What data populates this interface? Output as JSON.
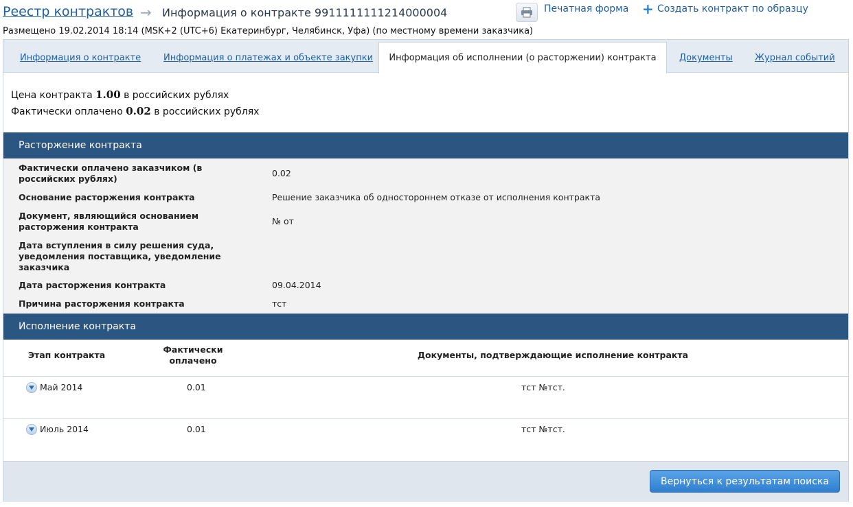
{
  "header": {
    "breadcrumb_root": "Реестр контрактов",
    "arrow_icon": "arrow-right-icon",
    "title": "Информация о контракте 9911111111214000004",
    "print_label": "Печатная форма",
    "print_icon": "printer-icon",
    "create_label": "Создать контракт по образцу",
    "create_icon": "plus-icon"
  },
  "posted": "Размещено 19.02.2014 18:14 (MSK+2 (UTC+6) Екатеринбург, Челябинск, Уфа) (по местному времени заказчика)",
  "tabs": [
    {
      "label": "Информация о контракте"
    },
    {
      "label": "Информация о платежах и объекте закупки"
    },
    {
      "label": "Информация об исполнении (о расторжении) контракта",
      "active": true
    },
    {
      "label": "Документы"
    },
    {
      "label": "Журнал событий"
    }
  ],
  "price": {
    "price_prefix": "Цена контракта",
    "price_value": "1.00",
    "price_suffix": "в российских рублях",
    "paid_prefix": "Фактически оплачено",
    "paid_value": "0.02",
    "paid_suffix": "в российских рублях"
  },
  "termination": {
    "title": "Расторжение контракта",
    "rows": [
      {
        "label": "Фактически оплачено заказчиком (в российских рублях)",
        "value": "0.02"
      },
      {
        "label": "Основание расторжения контракта",
        "value": "Решение заказчика об одностороннем отказе от исполнения контракта"
      },
      {
        "label": "Документ, являющийся основанием расторжения контракта",
        "value": "№ от"
      },
      {
        "label": "Дата вступления в силу решения суда, уведомления поставщика, уведомление заказчика",
        "value": ""
      },
      {
        "label": "Дата расторжения контракта",
        "value": "09.04.2014"
      },
      {
        "label": "Причина расторжения контракта",
        "value": "тст"
      }
    ]
  },
  "execution": {
    "title": "Исполнение контракта",
    "columns": [
      "Этап контракта",
      "Фактически оплачено",
      "Документы, подтверждающие исполнение контракта"
    ],
    "rows": [
      {
        "stage": "Май 2014",
        "paid": "0.01",
        "docs": "тст №тст."
      },
      {
        "stage": "Июль 2014",
        "paid": "0.01",
        "docs": "тст №тст."
      }
    ],
    "toggle_icon": "chevron-down-icon"
  },
  "footer": {
    "back_label": "Вернуться к результатам поиска"
  }
}
